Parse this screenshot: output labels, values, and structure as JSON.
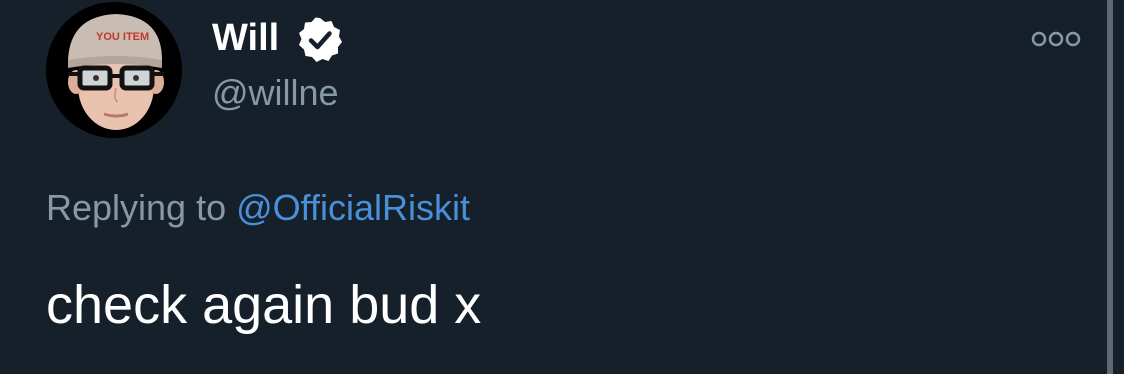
{
  "author": {
    "display_name": "Will",
    "handle": "@willne",
    "verified": true,
    "avatar_icon": "avatar-photo"
  },
  "reply_context": {
    "prefix": "Replying to",
    "mention": "@OfficialRiskit"
  },
  "tweet": {
    "text": "check again bud x"
  },
  "icons": {
    "verified": "verified-badge-icon",
    "more": "more-options-icon"
  },
  "colors": {
    "background": "#15202b",
    "secondary_text": "#8899a6",
    "link": "#4a90d9",
    "primary_text": "#ffffff"
  }
}
